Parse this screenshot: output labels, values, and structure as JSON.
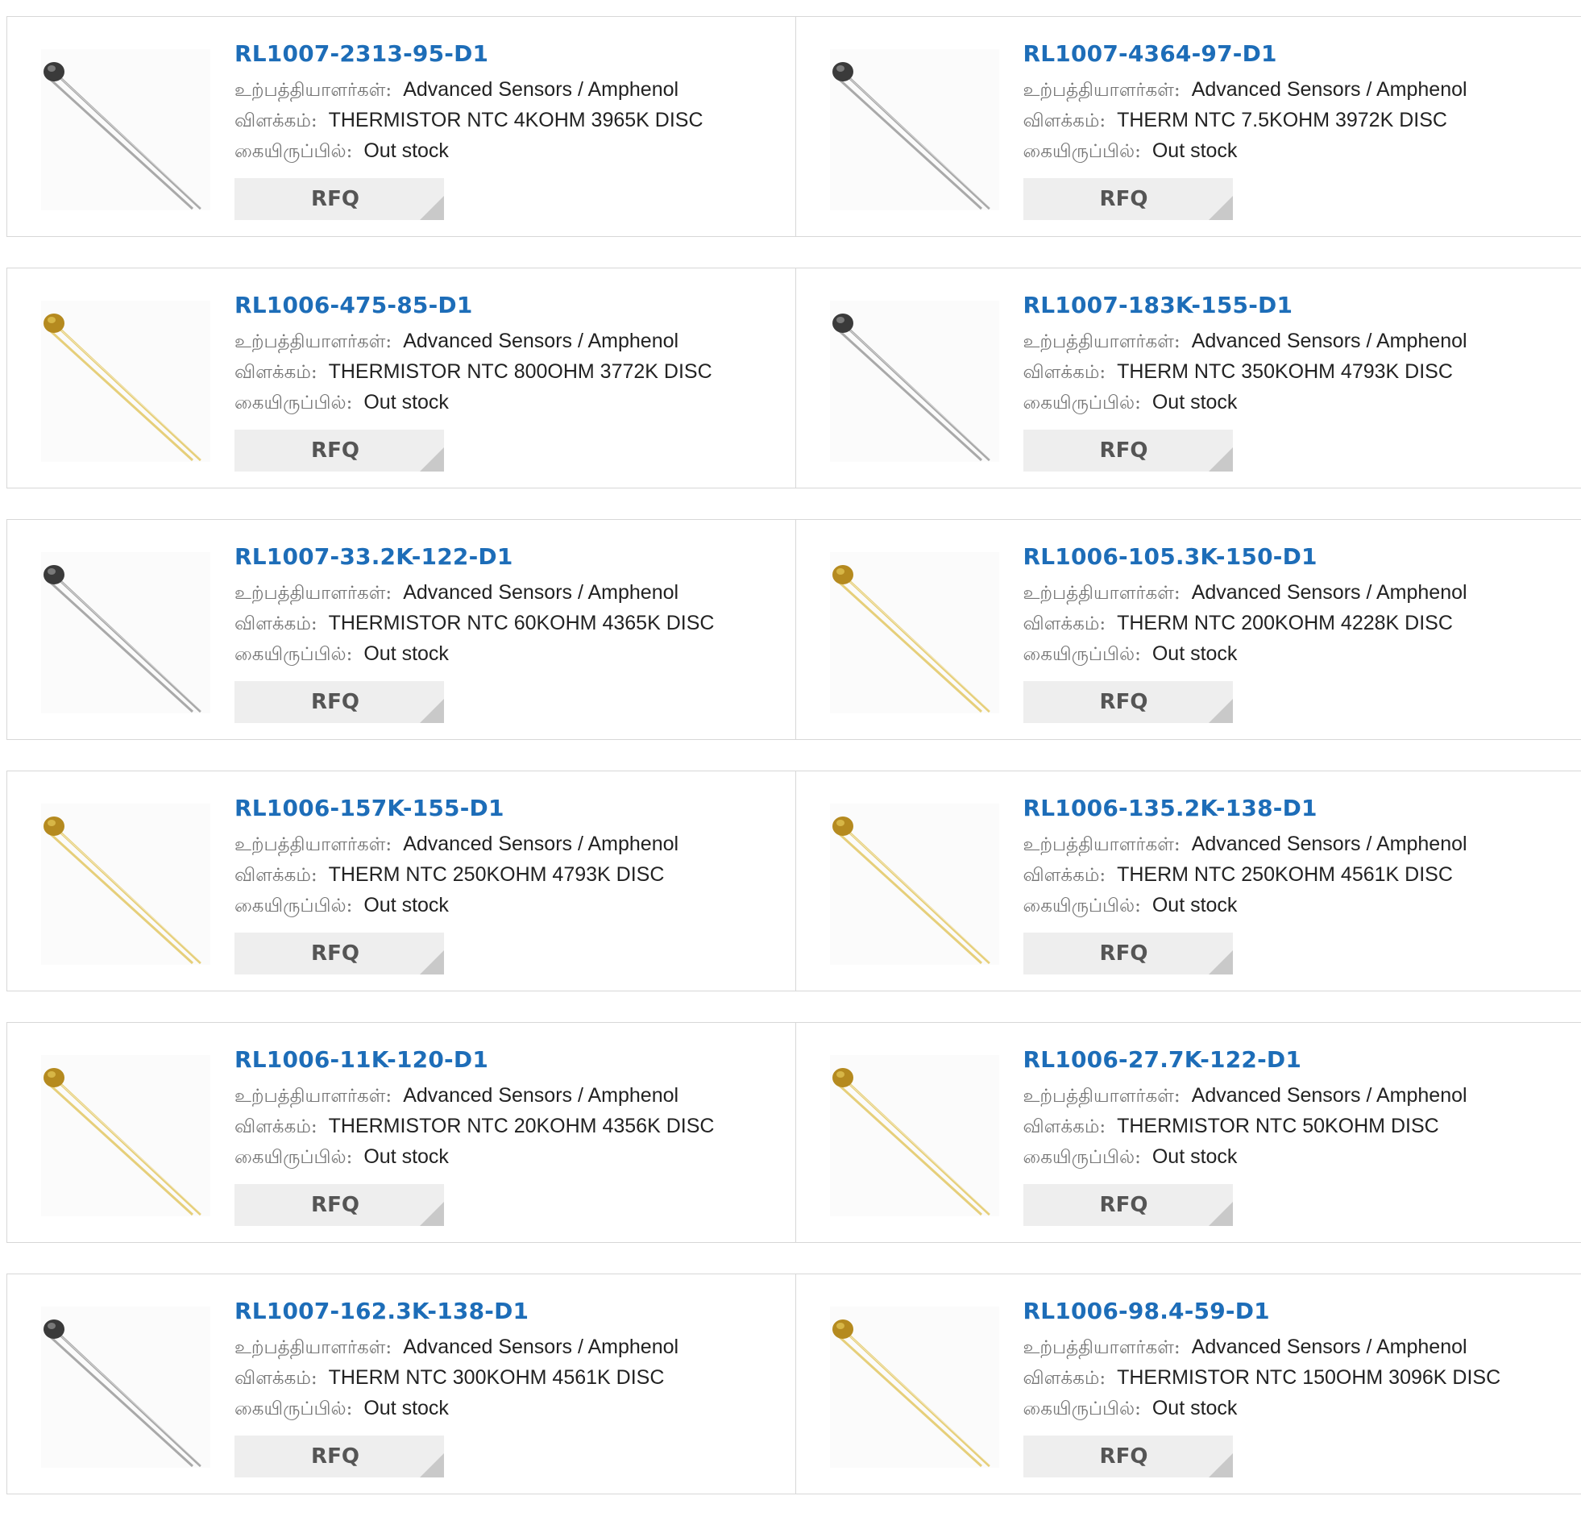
{
  "labels": {
    "manufacturer": "உற்பத்தியாளர்கள்:",
    "description": "விளக்கம்:",
    "stock": "கையிருப்பில்:"
  },
  "rfq_label": "RFQ",
  "products": [
    {
      "part": "RL1007-2313-95-D1",
      "manufacturer": "Advanced Sensors / Amphenol",
      "description": "THERMISTOR NTC 4KOHM 3965K DISC",
      "stock": "Out stock",
      "variant": "grey"
    },
    {
      "part": "RL1007-4364-97-D1",
      "manufacturer": "Advanced Sensors / Amphenol",
      "description": "THERM NTC 7.5KOHM 3972K DISC",
      "stock": "Out stock",
      "variant": "grey"
    },
    {
      "part": "RL1006-475-85-D1",
      "manufacturer": "Advanced Sensors / Amphenol",
      "description": "THERMISTOR NTC 800OHM 3772K DISC",
      "stock": "Out stock",
      "variant": "gold"
    },
    {
      "part": "RL1007-183K-155-D1",
      "manufacturer": "Advanced Sensors / Amphenol",
      "description": "THERM NTC 350KOHM 4793K DISC",
      "stock": "Out stock",
      "variant": "grey"
    },
    {
      "part": "RL1007-33.2K-122-D1",
      "manufacturer": "Advanced Sensors / Amphenol",
      "description": "THERMISTOR NTC 60KOHM 4365K DISC",
      "stock": "Out stock",
      "variant": "grey"
    },
    {
      "part": "RL1006-105.3K-150-D1",
      "manufacturer": "Advanced Sensors / Amphenol",
      "description": "THERM NTC 200KOHM 4228K DISC",
      "stock": "Out stock",
      "variant": "gold"
    },
    {
      "part": "RL1006-157K-155-D1",
      "manufacturer": "Advanced Sensors / Amphenol",
      "description": "THERM NTC 250KOHM 4793K DISC",
      "stock": "Out stock",
      "variant": "gold"
    },
    {
      "part": "RL1006-135.2K-138-D1",
      "manufacturer": "Advanced Sensors / Amphenol",
      "description": "THERM NTC 250KOHM 4561K DISC",
      "stock": "Out stock",
      "variant": "gold"
    },
    {
      "part": "RL1006-11K-120-D1",
      "manufacturer": "Advanced Sensors / Amphenol",
      "description": "THERMISTOR NTC 20KOHM 4356K DISC",
      "stock": "Out stock",
      "variant": "gold"
    },
    {
      "part": "RL1006-27.7K-122-D1",
      "manufacturer": "Advanced Sensors / Amphenol",
      "description": "THERMISTOR NTC 50KOHM DISC",
      "stock": "Out stock",
      "variant": "gold"
    },
    {
      "part": "RL1007-162.3K-138-D1",
      "manufacturer": "Advanced Sensors / Amphenol",
      "description": "THERM NTC 300KOHM 4561K DISC",
      "stock": "Out stock",
      "variant": "grey"
    },
    {
      "part": "RL1006-98.4-59-D1",
      "manufacturer": "Advanced Sensors / Amphenol",
      "description": "THERMISTOR NTC 150OHM 3096K DISC",
      "stock": "Out stock",
      "variant": "gold"
    }
  ],
  "colors": {
    "title": "#1d6db8",
    "border": "#d7d7d7",
    "rfq_bg": "#eeeeee",
    "gold_lead": "#e6cf7a",
    "gold_head": "#b58a1f",
    "grey_lead": "#a9a9a9",
    "grey_head": "#3a3a3a"
  }
}
